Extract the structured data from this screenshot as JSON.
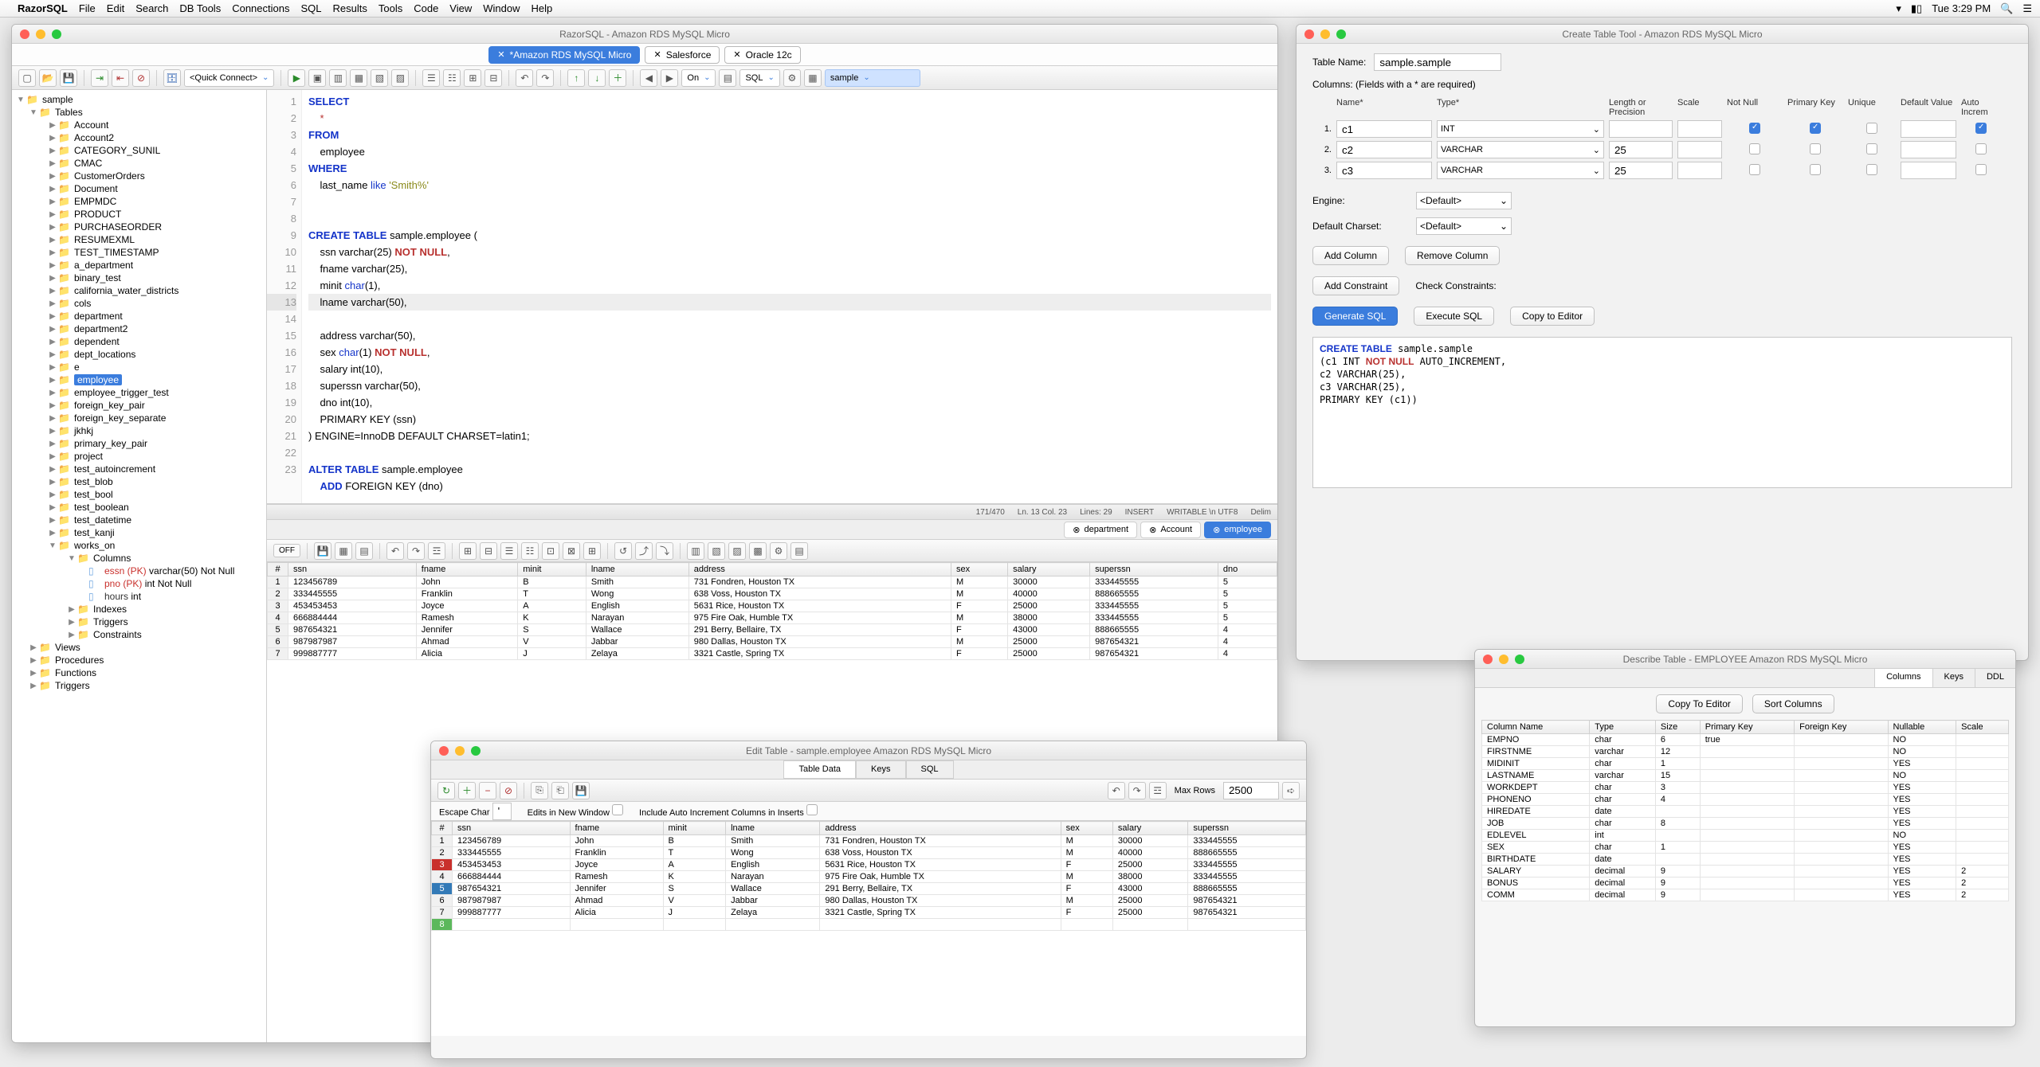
{
  "menubar": {
    "app": "RazorSQL",
    "items": [
      "File",
      "Edit",
      "Search",
      "DB Tools",
      "Connections",
      "SQL",
      "Results",
      "Tools",
      "Code",
      "View",
      "Window",
      "Help"
    ],
    "clock": "Tue 3:29 PM"
  },
  "mainwin": {
    "title": "RazorSQL - Amazon RDS MySQL Micro",
    "tabs": [
      {
        "label": "*Amazon RDS MySQL Micro",
        "active": true
      },
      {
        "label": "Salesforce",
        "active": false
      },
      {
        "label": "Oracle 12c",
        "active": false
      }
    ],
    "toolbar": {
      "quick_connect": "<Quick Connect>",
      "on": "On",
      "lang": "SQL",
      "schema": "sample"
    }
  },
  "tree": {
    "root": "sample",
    "tables_label": "Tables",
    "tables": [
      "Account",
      "Account2",
      "CATEGORY_SUNIL",
      "CMAC",
      "CustomerOrders",
      "Document",
      "EMPMDC",
      "PRODUCT",
      "PURCHASEORDER",
      "RESUMEXML",
      "TEST_TIMESTAMP",
      "a_department",
      "binary_test",
      "california_water_districts",
      "cols",
      "department",
      "department2",
      "dependent",
      "dept_locations",
      "e",
      "employee",
      "employee_trigger_test",
      "foreign_key_pair",
      "foreign_key_separate",
      "jkhkj",
      "primary_key_pair",
      "project",
      "test_autoincrement",
      "test_blob",
      "test_bool",
      "test_boolean",
      "test_datetime",
      "test_kanji",
      "works_on"
    ],
    "selected_table": "employee",
    "expanded_table": "works_on",
    "works_on_children": {
      "columns_label": "Columns",
      "columns": [
        {
          "name": "essn (PK)",
          "type": "varchar(50) Not Null"
        },
        {
          "name": "pno (PK)",
          "type": "int Not Null"
        },
        {
          "name": "hours",
          "type": "int"
        }
      ],
      "other": [
        "Indexes",
        "Triggers",
        "Constraints"
      ]
    },
    "siblings": [
      "Views",
      "Procedures",
      "Functions",
      "Triggers"
    ]
  },
  "editor": {
    "lines": [
      {
        "n": 1,
        "t": "SELECT",
        "cls": "kw"
      },
      {
        "n": 2,
        "t": "    *",
        "cls": "op"
      },
      {
        "n": 3,
        "t": "FROM",
        "cls": "kw"
      },
      {
        "n": 4,
        "t": "    employee"
      },
      {
        "n": 5,
        "t": "WHERE",
        "cls": "kw"
      },
      {
        "n": 6,
        "t": "    last_name <kw2>like</kw2> <str>'Smith%'</str>"
      },
      {
        "n": 7,
        "t": ""
      },
      {
        "n": 8,
        "t": ""
      },
      {
        "n": 9,
        "t": "<kw>CREATE</kw> <kw>TABLE</kw> sample.employee ("
      },
      {
        "n": 10,
        "t": "    ssn varchar(25) <nn>NOT</nn> <nn>NULL</nn>,"
      },
      {
        "n": 11,
        "t": "    fname varchar(25),"
      },
      {
        "n": 12,
        "t": "    minit <kw2>char</kw2>(1),"
      },
      {
        "n": 13,
        "t": "    lname varchar(50),",
        "current": true
      },
      {
        "n": 14,
        "t": "    address varchar(50),"
      },
      {
        "n": 15,
        "t": "    sex <kw2>char</kw2>(1) <nn>NOT</nn> <nn>NULL</nn>,"
      },
      {
        "n": 16,
        "t": "    salary int(10),"
      },
      {
        "n": 17,
        "t": "    superssn varchar(50),"
      },
      {
        "n": 18,
        "t": "    dno int(10),"
      },
      {
        "n": 19,
        "t": "    PRIMARY KEY (ssn)"
      },
      {
        "n": 20,
        "t": ") ENGINE=InnoDB DEFAULT CHARSET=latin1;"
      },
      {
        "n": 21,
        "t": ""
      },
      {
        "n": 22,
        "t": "<kw>ALTER</kw> <kw>TABLE</kw> sample.employee"
      },
      {
        "n": 23,
        "t": "    <kw>ADD</kw> FOREIGN KEY (dno)"
      }
    ],
    "status": {
      "pos": "171/470",
      "ln": "Ln. 13 Col. 23",
      "lines": "Lines: 29",
      "mode": "INSERT",
      "rw": "WRITABLE \\n UTF8",
      "delim": "Delim"
    }
  },
  "result_tabs": [
    {
      "label": "department",
      "active": false
    },
    {
      "label": "Account",
      "active": false
    },
    {
      "label": "employee",
      "active": true
    }
  ],
  "result_toolbar": {
    "off": "OFF"
  },
  "result_table": {
    "headers": [
      "#",
      "ssn",
      "fname",
      "minit",
      "lname",
      "address",
      "sex",
      "salary",
      "superssn",
      "dno"
    ],
    "rows": [
      [
        "1",
        "123456789",
        "John",
        "B",
        "Smith",
        "731 Fondren, Houston TX",
        "M",
        "30000",
        "333445555",
        "5"
      ],
      [
        "2",
        "333445555",
        "Franklin",
        "T",
        "Wong",
        "638 Voss, Houston TX",
        "M",
        "40000",
        "888665555",
        "5"
      ],
      [
        "3",
        "453453453",
        "Joyce",
        "A",
        "English",
        "5631 Rice, Houston TX",
        "F",
        "25000",
        "333445555",
        "5"
      ],
      [
        "4",
        "666884444",
        "Ramesh",
        "K",
        "Narayan",
        "975 Fire Oak, Humble TX",
        "M",
        "38000",
        "333445555",
        "5"
      ],
      [
        "5",
        "987654321",
        "Jennifer",
        "S",
        "Wallace",
        "291 Berry, Bellaire, TX",
        "F",
        "43000",
        "888665555",
        "4"
      ],
      [
        "6",
        "987987987",
        "Ahmad",
        "V",
        "Jabbar",
        "980 Dallas, Houston TX",
        "M",
        "25000",
        "987654321",
        "4"
      ],
      [
        "7",
        "999887777",
        "Alicia",
        "J",
        "Zelaya",
        "3321 Castle, Spring TX",
        "F",
        "25000",
        "987654321",
        "4"
      ]
    ]
  },
  "ctwin": {
    "title": "Create Table Tool - Amazon RDS MySQL Micro",
    "table_name_label": "Table Name:",
    "table_name": "sample.sample",
    "columns_label": "Columns: (Fields with a * are required)",
    "headers": {
      "name": "Name",
      "type": "Type",
      "len": "Length or Precision",
      "scale": "Scale",
      "nn": "Not Null",
      "pk": "Primary Key",
      "uq": "Unique",
      "dv": "Default Value",
      "ai": "Auto Increm"
    },
    "cols": [
      {
        "idx": "1.",
        "name": "c1",
        "type": "INT",
        "len": "",
        "nn": true,
        "pk": true,
        "uq": false,
        "ai": true
      },
      {
        "idx": "2.",
        "name": "c2",
        "type": "VARCHAR",
        "len": "25",
        "nn": false,
        "pk": false,
        "uq": false,
        "ai": false
      },
      {
        "idx": "3.",
        "name": "c3",
        "type": "VARCHAR",
        "len": "25",
        "nn": false,
        "pk": false,
        "uq": false,
        "ai": false
      }
    ],
    "engine_label": "Engine:",
    "engine": "<Default>",
    "charset_label": "Default Charset:",
    "charset": "<Default>",
    "add_col": "Add Column",
    "rem_col": "Remove Column",
    "add_cons": "Add Constraint",
    "chk_cons": "Check Constraints:",
    "gen_sql": "Generate SQL",
    "exec_sql": "Execute SQL",
    "copy": "Copy to Editor",
    "sql_out": "CREATE TABLE sample.sample\n(c1 INT NOT NULL AUTO_INCREMENT,\nc2 VARCHAR(25),\nc3 VARCHAR(25),\nPRIMARY KEY (c1))"
  },
  "dtwin": {
    "title": "Describe Table - EMPLOYEE Amazon RDS MySQL Micro",
    "tabs": [
      "Columns",
      "Keys",
      "DDL"
    ],
    "copy": "Copy To Editor",
    "sort": "Sort Columns",
    "headers": [
      "Column Name",
      "Type",
      "Size",
      "Primary Key",
      "Foreign Key",
      "Nullable",
      "Scale"
    ],
    "rows": [
      [
        "EMPNO",
        "char",
        "6",
        "true",
        "",
        "NO",
        ""
      ],
      [
        "FIRSTNME",
        "varchar",
        "12",
        "",
        "",
        "NO",
        ""
      ],
      [
        "MIDINIT",
        "char",
        "1",
        "",
        "",
        "YES",
        ""
      ],
      [
        "LASTNAME",
        "varchar",
        "15",
        "",
        "",
        "NO",
        ""
      ],
      [
        "WORKDEPT",
        "char",
        "3",
        "",
        "",
        "YES",
        ""
      ],
      [
        "PHONENO",
        "char",
        "4",
        "",
        "",
        "YES",
        ""
      ],
      [
        "HIREDATE",
        "date",
        "",
        "",
        "",
        "YES",
        ""
      ],
      [
        "JOB",
        "char",
        "8",
        "",
        "",
        "YES",
        ""
      ],
      [
        "EDLEVEL",
        "int",
        "",
        "",
        "",
        "NO",
        ""
      ],
      [
        "SEX",
        "char",
        "1",
        "",
        "",
        "YES",
        ""
      ],
      [
        "BIRTHDATE",
        "date",
        "",
        "",
        "",
        "YES",
        ""
      ],
      [
        "SALARY",
        "decimal",
        "9",
        "",
        "",
        "YES",
        "2"
      ],
      [
        "BONUS",
        "decimal",
        "9",
        "",
        "",
        "YES",
        "2"
      ],
      [
        "COMM",
        "decimal",
        "9",
        "",
        "",
        "YES",
        "2"
      ]
    ]
  },
  "etwin": {
    "title": "Edit Table - sample.employee Amazon RDS MySQL Micro",
    "tabs": [
      "Table Data",
      "Keys",
      "SQL"
    ],
    "maxrows_label": "Max Rows",
    "maxrows": "2500",
    "escape_label": "Escape Char",
    "escape": "'",
    "edits_label": "Edits in New Window",
    "incl_ai_label": "Include Auto Increment Columns in Inserts",
    "headers": [
      "#",
      "ssn",
      "fname",
      "minit",
      "lname",
      "address",
      "sex",
      "salary",
      "superssn"
    ],
    "rows": [
      {
        "rn": "1",
        "cls": "",
        "d": [
          "123456789",
          "John",
          "B",
          "Smith",
          "731 Fondren, Houston TX",
          "M",
          "30000",
          "333445555"
        ]
      },
      {
        "rn": "2",
        "cls": "",
        "d": [
          "333445555",
          "Franklin",
          "T",
          "Wong",
          "638 Voss, Houston TX",
          "M",
          "40000",
          "888665555"
        ]
      },
      {
        "rn": "3",
        "cls": "rn-red",
        "d": [
          "453453453",
          "Joyce",
          "A",
          "English",
          "5631 Rice, Houston TX",
          "F",
          "25000",
          "333445555"
        ]
      },
      {
        "rn": "4",
        "cls": "",
        "d": [
          "666884444",
          "Ramesh",
          "K",
          "Narayan",
          "975 Fire Oak, Humble TX",
          "M",
          "38000",
          "333445555"
        ]
      },
      {
        "rn": "5",
        "cls": "rn-blue",
        "d": [
          "987654321",
          "Jennifer",
          "S",
          "Wallace",
          "291 Berry, Bellaire, TX",
          "F",
          "43000",
          "888665555"
        ]
      },
      {
        "rn": "6",
        "cls": "",
        "d": [
          "987987987",
          "Ahmad",
          "V",
          "Jabbar",
          "980 Dallas, Houston TX",
          "M",
          "25000",
          "987654321"
        ]
      },
      {
        "rn": "7",
        "cls": "",
        "d": [
          "999887777",
          "Alicia",
          "J",
          "Zelaya",
          "3321 Castle, Spring TX",
          "F",
          "25000",
          "987654321"
        ]
      },
      {
        "rn": "8",
        "cls": "rn-grn032",
        "d": [
          "",
          "",
          "",
          "",
          "",
          "",
          "",
          ""
        ]
      }
    ]
  }
}
